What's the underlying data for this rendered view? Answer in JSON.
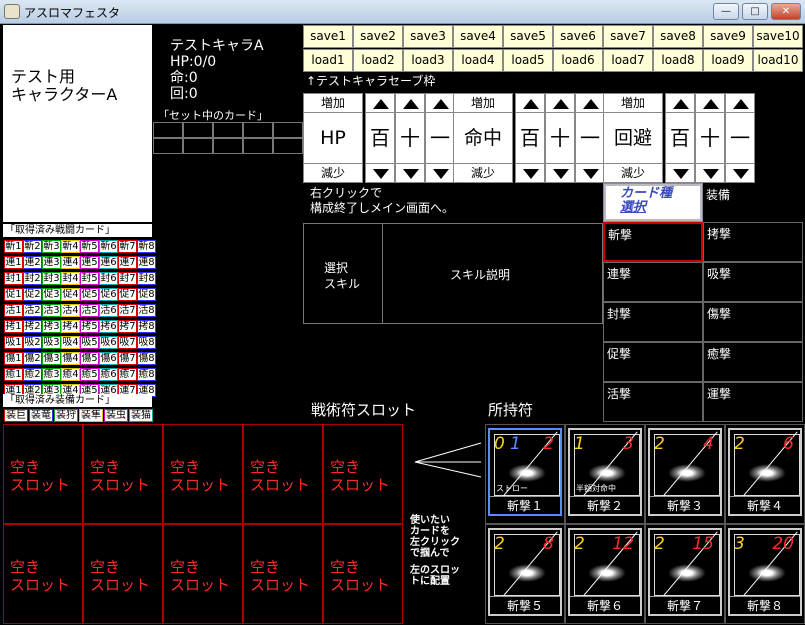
{
  "window": {
    "title": "アスロマフェスタ",
    "minimize": "—",
    "maximize": "□",
    "close": "✕"
  },
  "character": {
    "display_name_line1": "テスト用",
    "display_name_line2": "キャラクターA",
    "name": "テストキャラA",
    "hp": "HP:0/0",
    "accuracy": "命:0",
    "evasion": "回:0",
    "set_cards_label": "「セット中のカード」"
  },
  "save_buttons": [
    "save1",
    "save2",
    "save3",
    "save4",
    "save5",
    "save6",
    "save7",
    "save8",
    "save9",
    "save10"
  ],
  "load_buttons": [
    "load1",
    "load2",
    "load3",
    "load4",
    "load5",
    "load6",
    "load7",
    "load8",
    "load9",
    "load10"
  ],
  "save_frame_note": "↑テストキャラセーブ枠",
  "stats": [
    {
      "label": "HP",
      "increase": "増加",
      "decrease": "減少"
    },
    {
      "label": "命中",
      "increase": "増加",
      "decrease": "減少"
    },
    {
      "label": "回避",
      "increase": "増加",
      "decrease": "減少"
    }
  ],
  "digits": [
    "百",
    "十",
    "一"
  ],
  "right_click_note_1": "右クリックで",
  "right_click_note_2": "構成終了しメイン画面へ。",
  "card_type_select": {
    "line1": "カード種",
    "line2": "選択"
  },
  "equipment_label": "装備",
  "categories": [
    [
      "斬撃",
      "拷撃"
    ],
    [
      "連撃",
      "吸撃"
    ],
    [
      "封撃",
      "傷撃"
    ],
    [
      "促撃",
      "癒撃"
    ],
    [
      "活撃",
      "運撃"
    ]
  ],
  "skill": {
    "select_line1": "選択",
    "select_line2": "スキル",
    "description": "スキル説明"
  },
  "acquired_battle_cards_label": "「取得済み戦闘カード」",
  "battle_card_prefixes": [
    "斬",
    "連",
    "封",
    "促",
    "活",
    "拷",
    "吸",
    "傷",
    "癒",
    "運"
  ],
  "acquired_equipment_cards_label": "「取得済み装備カード」",
  "equipment_cards": [
    "装巨",
    "装竜",
    "装狩",
    "装隼",
    "装虫",
    "装猫"
  ],
  "tactic_slot_label": "戦術符スロット",
  "owned_label": "所持符",
  "empty_slot_line1": "空き",
  "empty_slot_line2": "スロット",
  "instruction": [
    "使いたい",
    "カードを",
    "左クリック",
    "で掴んで",
    "",
    "左のスロッ",
    "トに配置"
  ],
  "cards": [
    {
      "n1": "0",
      "n1b": "1",
      "n2": "2",
      "name": "斬撃１",
      "sub": "ストロー"
    },
    {
      "n1": "1",
      "n2": "3",
      "name": "斬撃２",
      "sub": "半額対命中"
    },
    {
      "n1": "2",
      "n2": "4",
      "name": "斬撃３",
      "sub": ""
    },
    {
      "n1": "2",
      "n2": "6",
      "name": "斬撃４",
      "sub": ""
    },
    {
      "n1": "2",
      "n2": "8",
      "name": "斬撃５",
      "sub": ""
    },
    {
      "n1": "2",
      "n2": "12",
      "name": "斬撃６",
      "sub": ""
    },
    {
      "n1": "2",
      "n2": "15",
      "name": "斬撃７",
      "sub": ""
    },
    {
      "n1": "3",
      "n2": "20",
      "name": "斬撃８",
      "sub": ""
    }
  ],
  "colors": {
    "battle_border": [
      "#d00",
      "#33f",
      "#0a0",
      "#e0c000",
      "#c0c",
      "#0aa",
      "#d00",
      "#33f"
    ],
    "card_highlight": "#5a8cff"
  }
}
